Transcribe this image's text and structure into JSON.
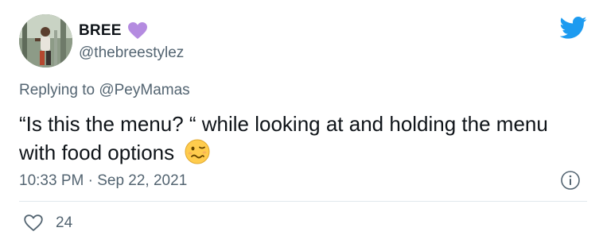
{
  "tweet": {
    "author": {
      "display_name": "BREE",
      "handle": "@thebreestylez",
      "badge_emoji": "purple-heart-icon"
    },
    "reply": {
      "prefix": "Replying to",
      "mention": "@PeyMamas"
    },
    "text": "“Is this the menu? “ while looking at and holding the menu with food options",
    "text_emoji": "woozy-face-icon",
    "timestamp": "10:33 PM · Sep 22, 2021",
    "like_count": "24"
  },
  "colors": {
    "twitter_blue": "#1d9bf0",
    "text_primary": "#0f1419",
    "text_secondary": "#536471",
    "purple_heart": "#b48be0",
    "divider": "#e1e8ed"
  },
  "icons": {
    "brand": "twitter-bird-icon",
    "info": "info-icon",
    "like": "heart-outline-icon"
  }
}
